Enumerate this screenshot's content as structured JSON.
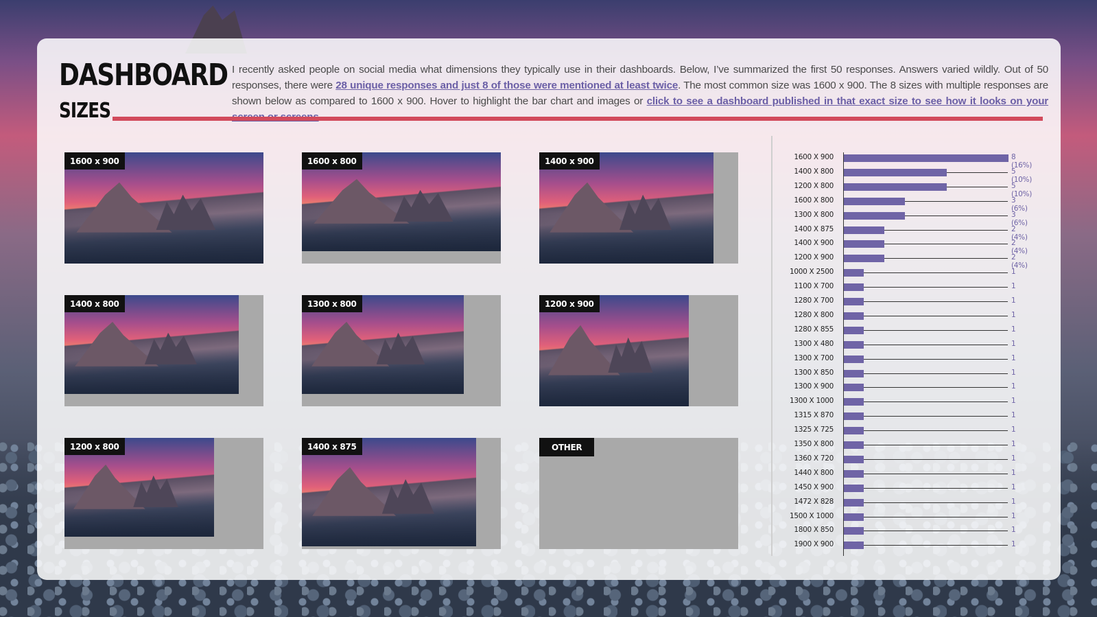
{
  "header": {
    "title": "DASHBOARD",
    "subtitle": "SIZES",
    "intro_part1": "I recently asked people on social media what dimensions they typically use in their dashboards. Below, I’ve summarized the first 50 responses. Answers varied wildly. Out of 50 responses, there were ",
    "intro_link1": "28 unique responses and just 8 of those were mentioned at least twice",
    "intro_part2": ". The most common size was 1600 x 900. The 8 sizes with multiple responses are shown below as compared to 1600 x 900. Hover to highlight the bar chart and images or ",
    "intro_link2": "click to see a dashboard published in that exact size to see how it looks on your screen or screens",
    "intro_part3": "."
  },
  "thumbnails": [
    {
      "label": "1600 x 900"
    },
    {
      "label": "1600 x 800"
    },
    {
      "label": "1400 x 900"
    },
    {
      "label": "1400 x 800"
    },
    {
      "label": "1300 x 800"
    },
    {
      "label": "1200 x 900"
    },
    {
      "label": "1200 x 800"
    },
    {
      "label": "1400 x 875"
    },
    {
      "label": "OTHER"
    }
  ],
  "colors": {
    "accent_bar": "#6f64a6",
    "rule_red": "#d24a5c",
    "panel_bg": "#ffffff"
  },
  "chart_data": {
    "type": "bar",
    "orientation": "horizontal",
    "categories": [
      "1600 X 900",
      "1400 X 800",
      "1200 X 800",
      "1600 X 800",
      "1300 X 800",
      "1400 X 875",
      "1400 X 900",
      "1200 X 900",
      "1000 X 2500",
      "1100 X 700",
      "1280 X 700",
      "1280 X 800",
      "1280 X 855",
      "1300 X 480",
      "1300 X 700",
      "1300 X 850",
      "1300 X 900",
      "1300 X 1000",
      "1315 X 870",
      "1325 X 725",
      "1350 X 800",
      "1360 X 720",
      "1440 X 800",
      "1450 X 900",
      "1472 X 828",
      "1500 X 1000",
      "1800 X 850",
      "1900 X 900"
    ],
    "values": [
      8,
      5,
      5,
      3,
      3,
      2,
      2,
      2,
      1,
      1,
      1,
      1,
      1,
      1,
      1,
      1,
      1,
      1,
      1,
      1,
      1,
      1,
      1,
      1,
      1,
      1,
      1,
      1
    ],
    "value_labels": [
      "8 (16%)",
      "5 (10%)",
      "5 (10%)",
      "3 (6%)",
      "3 (6%)",
      "2 (4%)",
      "2 (4%)",
      "2 (4%)",
      "1",
      "1",
      "1",
      "1",
      "1",
      "1",
      "1",
      "1",
      "1",
      "1",
      "1",
      "1",
      "1",
      "1",
      "1",
      "1",
      "1",
      "1",
      "1",
      "1"
    ],
    "xlim": [
      0,
      8
    ]
  }
}
